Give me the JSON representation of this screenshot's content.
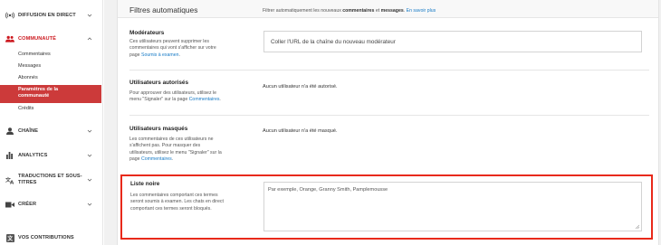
{
  "sidebar": {
    "live": {
      "label": "DIFFUSION EN DIRECT",
      "icon": "live-broadcast-icon"
    },
    "community": {
      "label": "COMMUNAUTÉ",
      "icon": "community-icon",
      "items": [
        "Commentaires",
        "Messages",
        "Abonnés",
        "Paramètres de la communauté",
        "Crédits"
      ],
      "active_line1": "Paramètres de la",
      "active_line2": "communauté"
    },
    "channel": {
      "label": "CHAÎNE",
      "icon": "channel-icon"
    },
    "analytics": {
      "label": "ANALYTICS",
      "icon": "analytics-icon"
    },
    "translations": {
      "label_line1": "TRADUCTIONS ET SOUS-",
      "label_line2": "TITRES",
      "icon": "translate-icon"
    },
    "create": {
      "label": "CRÉER",
      "icon": "video-camera-icon"
    },
    "contributions": {
      "label": "VOS CONTRIBUTIONS",
      "icon": "contributions-icon"
    }
  },
  "filters": {
    "title": "Filtres automatiques",
    "desc_prefix": "Filtrer automatiquement les nouveaux ",
    "desc_bold1": "commentaires",
    "desc_mid": " et ",
    "desc_bold2": "messages",
    "desc_suffix": ". ",
    "learn_more": "En savoir plus",
    "moderators": {
      "label": "Modérateurs",
      "desc_line1": "Ces utilisateurs peuvent supprimer les",
      "desc_line2": "commentaires qui vont s'afficher sur votre",
      "desc_line3_prefix": "page ",
      "desc_line3_link": "Soumis à examen",
      "desc_line3_suffix": ".",
      "placeholder": "Coller l'URL de la chaîne du nouveau modérateur"
    },
    "approved": {
      "label": "Utilisateurs autorisés",
      "desc_line1": "Pour approuver des utilisateurs, utilisez le",
      "desc_line2_prefix": "menu \"Signaler\" sur la page ",
      "desc_line2_link": "Commentaires",
      "desc_line2_suffix": ".",
      "value": "Aucun utilisateur n'a été autorisé."
    },
    "hidden": {
      "label": "Utilisateurs masqués",
      "desc_line1": "Les commentaires de ces utilisateurs ne",
      "desc_line2": "s'affichent pas. Pour masquer des",
      "desc_line3": "utilisateurs, utilisez le menu \"Signaler\" sur la",
      "desc_line4_prefix": "page ",
      "desc_line4_link": "Commentaires",
      "desc_line4_suffix": ".",
      "value": "Aucun utilisateur n'a été masqué."
    },
    "blacklist": {
      "label": "Liste noire",
      "desc_line1": "Les commentaires comportant ces termes",
      "desc_line2": "seront soumis à examen. Les chats en direct",
      "desc_line3": "comportant ces termes seront bloqués.",
      "placeholder": "Par exemple, Orange, Granny Smith, Pamplemousse"
    }
  },
  "colors": {
    "accent_red": "#cc181e",
    "active_bg": "#cc3a3a",
    "highlight": "#e8291a",
    "link": "#167ac6"
  }
}
